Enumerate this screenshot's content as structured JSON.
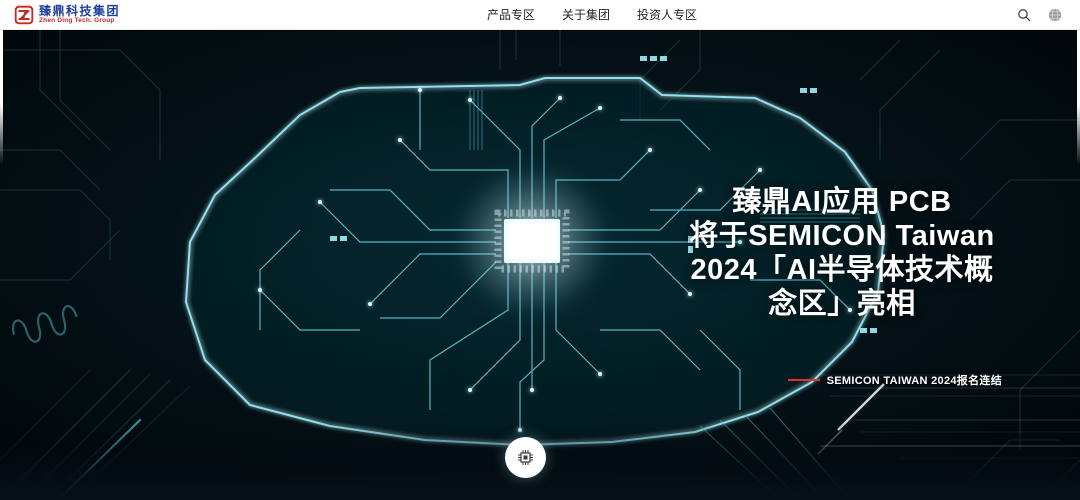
{
  "header": {
    "logo": {
      "title_zh": "臻鼎科技集团",
      "subtitle_en": "Zhen Ding Tech. Group",
      "mark_icon": "zd-monogram-red-square",
      "brand_blue": "#1b3e9e",
      "brand_red": "#c8281e"
    },
    "nav_items": [
      {
        "label": "产品专区"
      },
      {
        "label": "关于集团"
      },
      {
        "label": "投资人专区"
      }
    ],
    "search_icon": "magnifier",
    "language_icon": "globe"
  },
  "hero": {
    "headline_lines": [
      "臻鼎AI应用 PCB",
      "将于SEMICON Taiwan",
      "2024「AI半导体技术概",
      "念区」亮相"
    ],
    "registration_link": {
      "label": "SEMICON TAIWAN 2024报名连结",
      "accent_color": "#df3528"
    },
    "scroll_button_icon": "cpu-chip",
    "art_colors": {
      "background": "#020a0e",
      "trace_cyan": "#5fd0e2",
      "outline_glow": "#aef2fb",
      "chip_white": "#ffffff"
    }
  }
}
